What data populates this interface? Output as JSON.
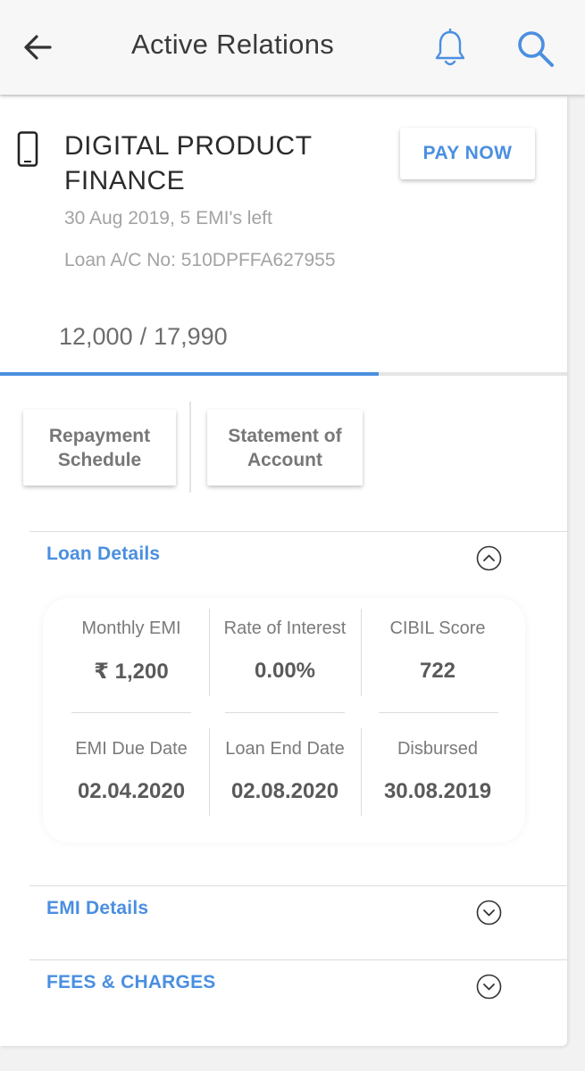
{
  "header": {
    "title": "Active Relations",
    "back_icon": "arrow-left-icon",
    "notification_icon": "bell-icon",
    "search_icon": "search-icon"
  },
  "product": {
    "icon": "smartphone-icon",
    "name": "DIGITAL PRODUCT FINANCE",
    "pay_now_label": "PAY NOW",
    "date_line": "30 Aug 2019, 5 EMI's left",
    "loan_account": "Loan A/C No: 510DPFFA627955",
    "paid_amount": "12,000",
    "separator": "/",
    "total_amount": "17,990",
    "progress_fraction": 0.667
  },
  "actions": {
    "repayment_schedule": "Repayment Schedule",
    "statement_of_account": "Statement of Account"
  },
  "loan_details": {
    "title": "Loan Details",
    "expanded": true,
    "items": [
      {
        "label": "Monthly EMI",
        "value": "₹ 1,200"
      },
      {
        "label": "Rate of Interest",
        "value": "0.00%"
      },
      {
        "label": "CIBIL Score",
        "value": "722"
      },
      {
        "label": "EMI Due Date",
        "value": "02.04.2020"
      },
      {
        "label": "Loan End Date",
        "value": "02.08.2020"
      },
      {
        "label": "Disbursed",
        "value": "30.08.2019"
      }
    ]
  },
  "emi_details": {
    "title": "EMI Details",
    "expanded": false
  },
  "fees_charges": {
    "title": "FEES & CHARGES",
    "expanded": false
  },
  "colors": {
    "accent": "#4a8fe0",
    "title_text": "#3a3a3a",
    "muted_text": "#a3a3a3",
    "background": "#f2f2f2"
  }
}
